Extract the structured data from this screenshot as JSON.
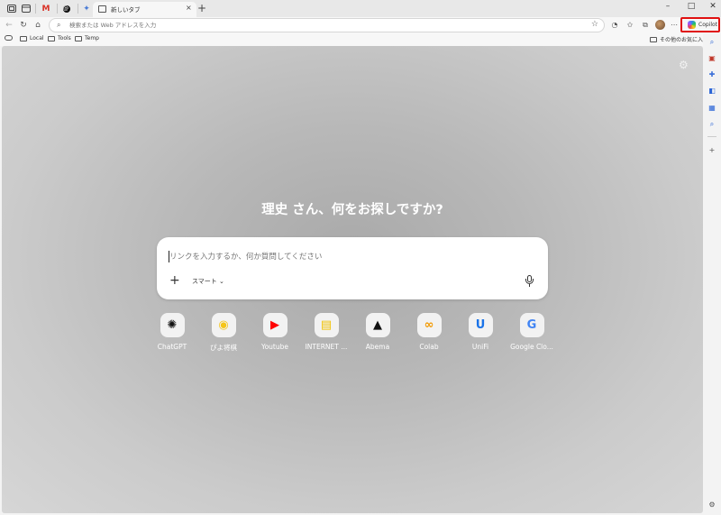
{
  "tabs": {
    "active_title": "新しいタブ",
    "close_glyph": "×",
    "new_tab_glyph": "+"
  },
  "window": {
    "minimize_glyph": "–",
    "maximize_glyph": "□",
    "close_glyph": "✕"
  },
  "address_bar": {
    "placeholder": "検索または Web アドレスを入力"
  },
  "copilot": {
    "label": "Copilot"
  },
  "favorites": {
    "items": [
      "Local",
      "Tools",
      "Temp"
    ],
    "other": "その他のお気に入り"
  },
  "new_tab_page": {
    "greeting": "理史 さん、何をお探しですか?",
    "search_placeholder": "リンクを入力するか、何か質問してください",
    "mode_label": "スマート ⌄",
    "tiles": [
      {
        "label": "ChatGPT",
        "icon": "chatgpt-icon",
        "color": "#111111",
        "glyph": "✺"
      },
      {
        "label": "ぴよ将棋",
        "icon": "piyo-shogi-icon",
        "color": "#f5c518",
        "glyph": "◉"
      },
      {
        "label": "Youtube",
        "icon": "youtube-icon",
        "color": "#ff0000",
        "glyph": "▶"
      },
      {
        "label": "INTERNET ...",
        "icon": "internet-icon",
        "color": "#f2c200",
        "glyph": "▤"
      },
      {
        "label": "Abema",
        "icon": "abema-icon",
        "color": "#111111",
        "glyph": "▲"
      },
      {
        "label": "Colab",
        "icon": "colab-icon",
        "color": "#f29900",
        "glyph": "∞"
      },
      {
        "label": "UniFi",
        "icon": "unifi-icon",
        "color": "#1a73e8",
        "glyph": "U"
      },
      {
        "label": "Google Clo...",
        "icon": "google-icon",
        "color": "#4285f4",
        "glyph": "G"
      }
    ]
  }
}
